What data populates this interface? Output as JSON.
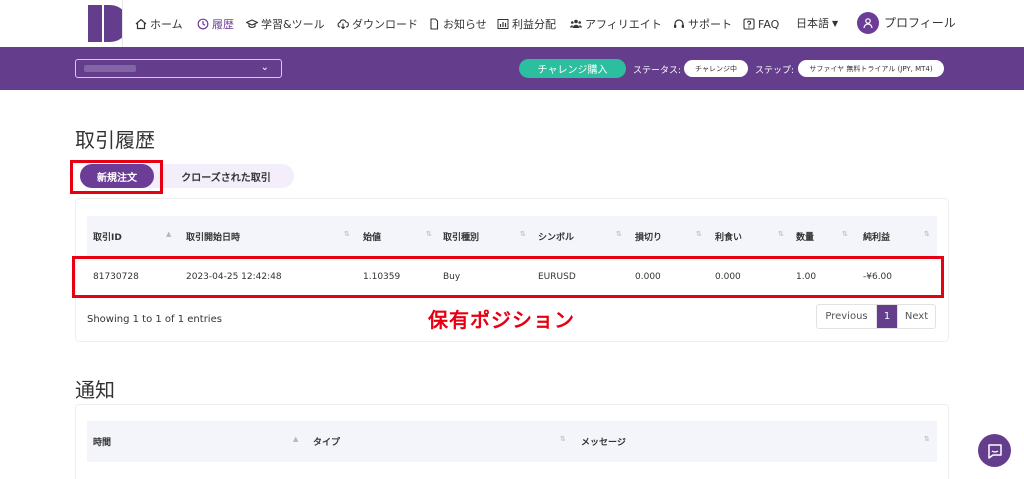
{
  "nav": {
    "home": "ホーム",
    "history": "履歴",
    "learning": "学習&ツール",
    "download": "ダウンロード",
    "news": "お知らせ",
    "profit_share": "利益分配",
    "affiliate": "アフィリエイト",
    "support": "サポート",
    "faq": "FAQ",
    "language": "日本語",
    "profile": "プロフィール"
  },
  "subbar": {
    "challenge_button": "チャレンジ購入",
    "status_label": "ステータス:",
    "status_value": "チャレンジ中",
    "step_label": "ステップ:",
    "step_value": "サファイヤ 無料トライアル (JPY, MT4)"
  },
  "trade_history": {
    "title": "取引履歴",
    "tabs": [
      "新規注文",
      "クローズされた取引"
    ],
    "columns": [
      "取引ID",
      "取引開始日時",
      "始値",
      "取引種別",
      "シンボル",
      "損切り",
      "利食い",
      "数量",
      "純利益"
    ],
    "rows": [
      [
        "81730728",
        "2023-04-25 12:42:48",
        "1.10359",
        "Buy",
        "EURUSD",
        "0.000",
        "0.000",
        "1.00",
        "-¥6.00"
      ]
    ],
    "showing": "Showing 1 to 1 of 1 entries",
    "pagination": {
      "previous": "Previous",
      "current": "1",
      "next": "Next"
    },
    "annotation": "保有ポジション"
  },
  "notifications": {
    "title": "通知",
    "columns": [
      "時間",
      "タイプ",
      "メッセージ"
    ]
  },
  "colors": {
    "brand_purple": "#643e8c",
    "accent_green": "#2bbf9f",
    "highlight_red": "#e60012"
  }
}
